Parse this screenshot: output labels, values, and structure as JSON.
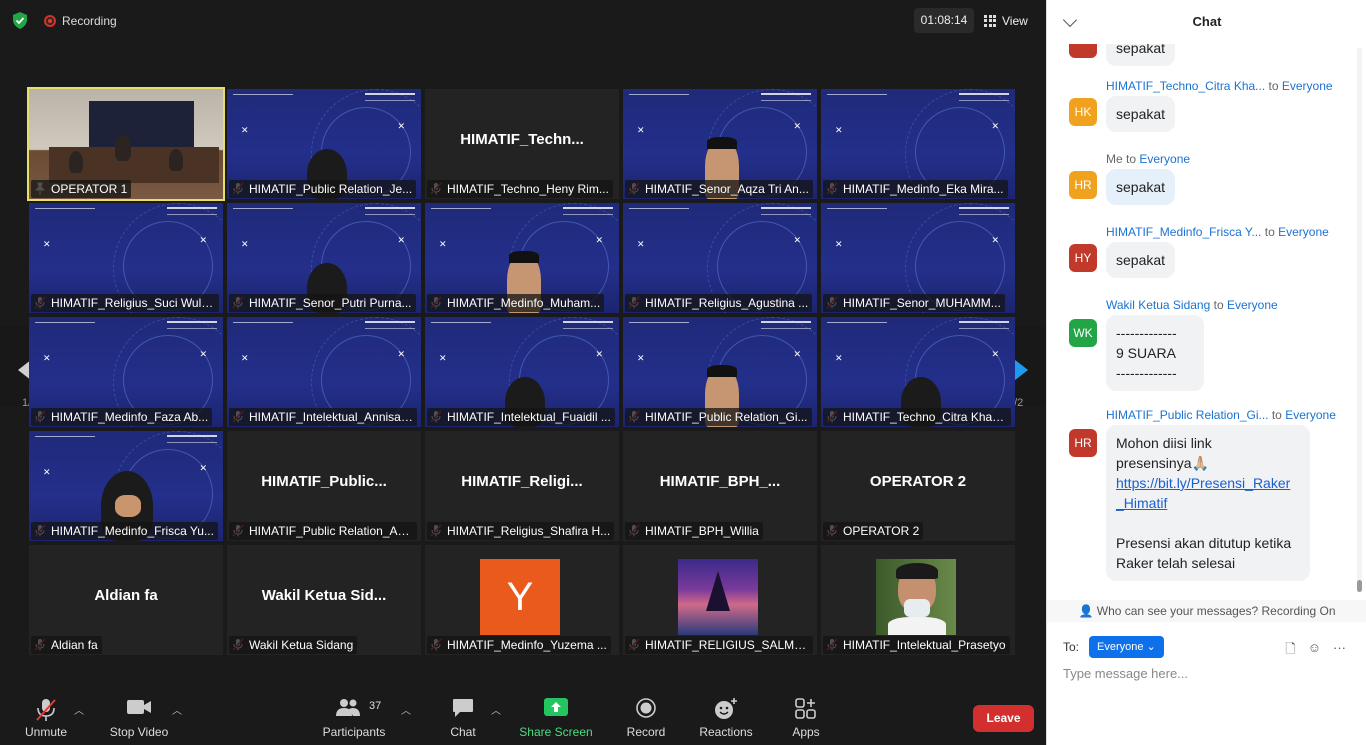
{
  "topbar": {
    "recording_label": "Recording",
    "timer": "01:08:14",
    "view_label": "View"
  },
  "pagination": {
    "left": "1/2",
    "right": "1/2"
  },
  "tiles": [
    {
      "label": "OPERATOR 1",
      "big": ""
    },
    {
      "label": "HIMATIF_Public Relation_Je...",
      "big": ""
    },
    {
      "label": "HIMATIF_Techno_Heny Rim...",
      "big": "HIMATIF_Techn..."
    },
    {
      "label": "HIMATIF_Senor_Aqza Tri An...",
      "big": ""
    },
    {
      "label": "HIMATIF_Medinfo_Eka Mira...",
      "big": ""
    },
    {
      "label": "HIMATIF_Religius_Suci Wula...",
      "big": ""
    },
    {
      "label": "HIMATIF_Senor_Putri Purna...",
      "big": ""
    },
    {
      "label": "HIMATIF_Medinfo_Muham...",
      "big": ""
    },
    {
      "label": "HIMATIF_Religius_Agustina ...",
      "big": ""
    },
    {
      "label": "HIMATIF_Senor_MUHAMM...",
      "big": ""
    },
    {
      "label": "HIMATIF_Medinfo_Faza Ab...",
      "big": ""
    },
    {
      "label": "HIMATIF_Intelektual_Annisa ...",
      "big": ""
    },
    {
      "label": "HIMATIF_Intelektual_Fuaidil ...",
      "big": ""
    },
    {
      "label": "HIMATIF_Public Relation_Gi...",
      "big": ""
    },
    {
      "label": "HIMATIF_Techno_Citra Khae...",
      "big": ""
    },
    {
      "label": "HIMATIF_Medinfo_Frisca Yu...",
      "big": ""
    },
    {
      "label": "HIMATIF_Public Relation_Ad...",
      "big": "HIMATIF_Public..."
    },
    {
      "label": "HIMATIF_Religius_Shafira H...",
      "big": "HIMATIF_Religi..."
    },
    {
      "label": "HIMATIF_BPH_Willia",
      "big": "HIMATIF_BPH_..."
    },
    {
      "label": "OPERATOR 2",
      "big": "OPERATOR 2"
    },
    {
      "label": "Aldian fa",
      "big": "Aldian fa"
    },
    {
      "label": "Wakil Ketua Sidang",
      "big": "Wakil  Ketua  Sid..."
    },
    {
      "label": "HIMATIF_Medinfo_Yuzema ...",
      "big": "",
      "avatar_letter": "Y"
    },
    {
      "label": "HIMATIF_RELIGIUS_SALMA AIN...",
      "big": ""
    },
    {
      "label": "HIMATIF_Intelektual_Prasetyo",
      "big": ""
    }
  ],
  "toolbar": {
    "unmute": "Unmute",
    "stop_video": "Stop Video",
    "participants": "Participants",
    "participants_count": "37",
    "chat": "Chat",
    "share_screen": "Share Screen",
    "record": "Record",
    "reactions": "Reactions",
    "apps": "Apps",
    "leave": "Leave"
  },
  "chat": {
    "title": "Chat",
    "messages": [
      {
        "sender": "",
        "to": "",
        "avatar": "",
        "text": "sepakat"
      },
      {
        "sender": "HIMATIF_Techno_Citra Kha...",
        "to": "Everyone",
        "avatar": "HK",
        "text": "sepakat"
      },
      {
        "sender": "Me",
        "to": "Everyone",
        "avatar": "HR",
        "text": "sepakat"
      },
      {
        "sender": "HIMATIF_Medinfo_Frisca Y...",
        "to": "Everyone",
        "avatar": "HY",
        "text": "sepakat"
      },
      {
        "sender": "Wakil Ketua Sidang",
        "to": "Everyone",
        "avatar": "WK",
        "text": "-------------",
        "text2": "9 SUARA",
        "text3": "-------------"
      },
      {
        "sender": "HIMATIF_Public Relation_Gi...",
        "to": "Everyone",
        "avatar": "HR",
        "text": "Mohon diisi link",
        "text2": "presensinya🙏🏼",
        "link": "https://bit.ly/Presensi_Raker",
        "link2": "_Himatif",
        "text3": "Presensi akan ditutup ketika",
        "text4": "Raker telah selesai"
      }
    ],
    "to_word": "to",
    "who_can_see": "Who can see your messages? Recording On",
    "to_label": "To:",
    "to_value": "Everyone",
    "input_placeholder": "Type message here..."
  },
  "colors": {
    "accent": "#0e71eb",
    "leave": "#d32f2f",
    "active_speaker": "#e6e06a",
    "share": "#22c55e"
  }
}
